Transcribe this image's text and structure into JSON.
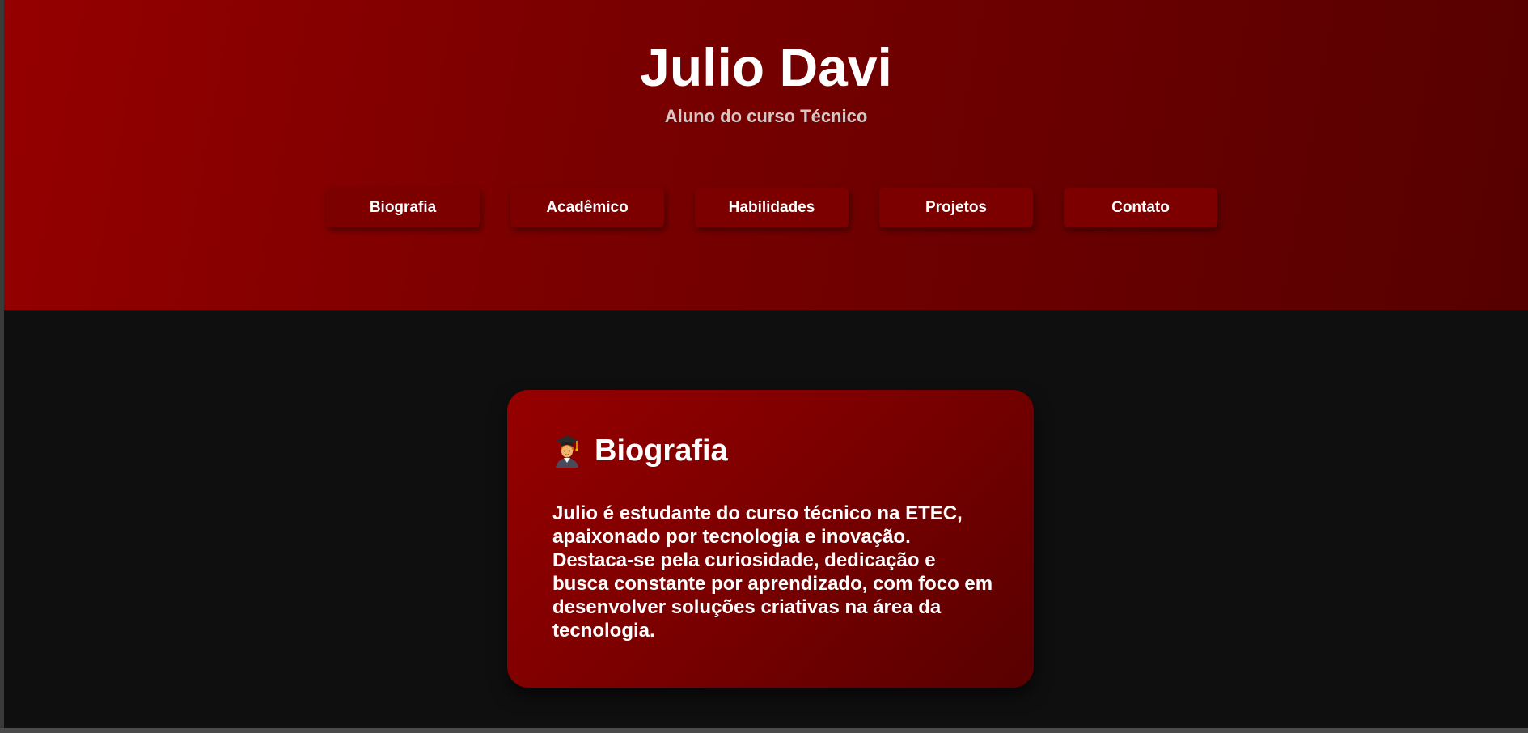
{
  "header": {
    "title": "Julio Davi",
    "subtitle": "Aluno do curso Técnico"
  },
  "nav": {
    "items": [
      {
        "label": "Biografia"
      },
      {
        "label": "Acadêmico"
      },
      {
        "label": "Habilidades"
      },
      {
        "label": "Projetos"
      },
      {
        "label": "Contato"
      }
    ]
  },
  "bio_card": {
    "icon": "student-graduate-icon",
    "title": "Biografia",
    "text": "Julio é estudante do curso técnico na ETEC, apaixonado por tecnologia e inovação. Destaca-se pela curiosidade, dedicação e busca constante por aprendizado, com foco em desenvolver soluções criativas na área da tecnologia."
  },
  "colors": {
    "hero_gradient_start": "#950000",
    "hero_gradient_end": "#560000",
    "background": "#0f0f0f",
    "button": "#7c0000",
    "text": "#ffffff"
  }
}
